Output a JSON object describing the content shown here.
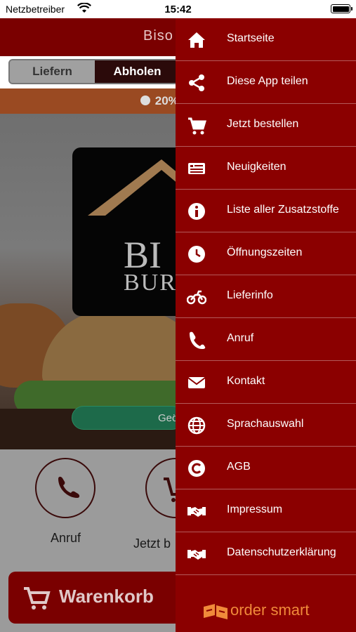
{
  "status_bar": {
    "carrier": "Netzbetreiber",
    "time": "15:42"
  },
  "app": {
    "title": "Biso",
    "segments": [
      "Liefern",
      "Abholen"
    ],
    "promo": "20%",
    "logo_line1": "BI",
    "logo_line2": "BUR",
    "open_badge": "Geö",
    "actions": {
      "call": "Anruf",
      "order": "Jetzt b"
    },
    "cart": "Warenkorb"
  },
  "drawer": {
    "items": [
      {
        "label": "Startseite",
        "icon": "home-icon"
      },
      {
        "label": "Diese App teilen",
        "icon": "share-icon"
      },
      {
        "label": "Jetzt bestellen",
        "icon": "cart-icon"
      },
      {
        "label": "Neuigkeiten",
        "icon": "news-icon"
      },
      {
        "label": "Liste aller Zusatzstoffe",
        "icon": "info-icon"
      },
      {
        "label": "Öffnungszeiten",
        "icon": "clock-icon"
      },
      {
        "label": "Lieferinfo",
        "icon": "motorcycle-icon"
      },
      {
        "label": "Anruf",
        "icon": "phone-icon"
      },
      {
        "label": "Kontakt",
        "icon": "mail-icon"
      },
      {
        "label": "Sprachauswahl",
        "icon": "globe-icon"
      },
      {
        "label": "AGB",
        "icon": "copyright-icon"
      },
      {
        "label": "Impressum",
        "icon": "handshake-icon"
      },
      {
        "label": "Datenschutzerklärung",
        "icon": "handshake-icon"
      }
    ],
    "brand": "order smart"
  },
  "colors": {
    "primary": "#8b0000",
    "brand_orange": "#f08a3a"
  }
}
